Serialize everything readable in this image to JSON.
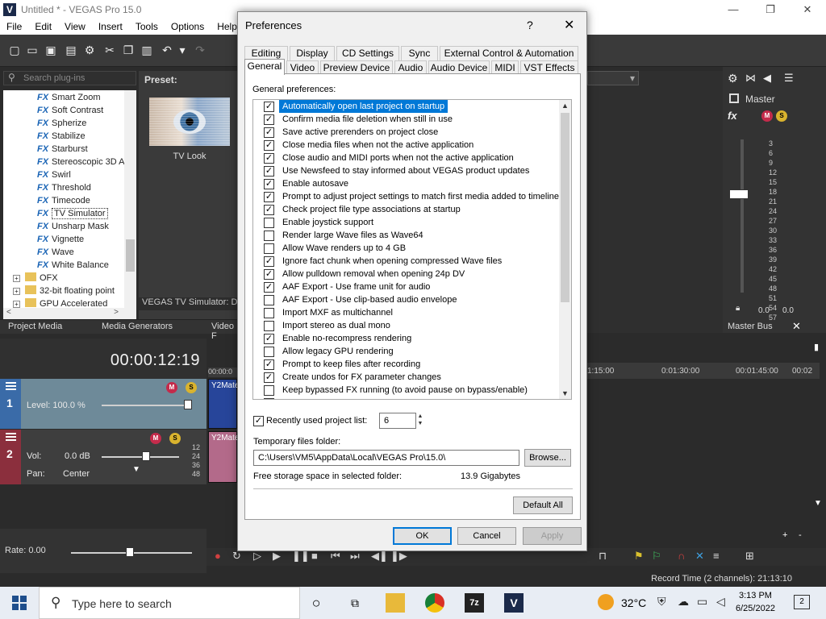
{
  "window": {
    "title": "Untitled * - VEGAS Pro 15.0",
    "controls": [
      "—",
      "❐",
      "✕"
    ]
  },
  "menu": [
    "File",
    "Edit",
    "View",
    "Insert",
    "Tools",
    "Options",
    "Help"
  ],
  "left_panel": {
    "search_placeholder": "Search plug-ins",
    "preset_label": "Preset:",
    "plugins": [
      "Smart Zoom",
      "Soft Contrast",
      "Spherize",
      "Stabilize",
      "Starburst",
      "Stereoscopic 3D A",
      "Swirl",
      "Threshold",
      "Timecode",
      "TV Simulator",
      "Unsharp Mask",
      "Vignette",
      "Wave",
      "White Balance"
    ],
    "fx_badge": "FX",
    "selected_plugin": "TV Simulator",
    "folders": [
      "OFX",
      "32-bit floating point",
      "GPU Accelerated"
    ],
    "preset_name": "TV Look",
    "status": "VEGAS TV Simulator: DXT",
    "tabs": [
      "Project Media",
      "Media Generators",
      "Video F"
    ]
  },
  "timeline": {
    "timecode": "00:00:12:19",
    "track1": {
      "number": "1",
      "level_label": "Level: 100.0 %",
      "level": 1.0,
      "clip_label": "Y2Mate"
    },
    "track2": {
      "number": "2",
      "vol_label": "Vol:",
      "vol_value": "0.0 dB",
      "pan_label": "Pan:",
      "pan_value": "Center",
      "clip_label": "Y2Mate"
    },
    "ruler_ticks": [
      "00:00:0",
      "1:15:00",
      "0:01:30:00",
      "00:01:45:00",
      "00:02"
    ],
    "levels": [
      "12",
      "24",
      "36",
      "48"
    ],
    "rate": "Rate: 0.00",
    "record_time": "Record Time (2 channels): 21:13:10"
  },
  "mixer": {
    "master_label": "Master",
    "fx_label": "fx",
    "scale": [
      "3",
      "6",
      "9",
      "12",
      "15",
      "18",
      "21",
      "24",
      "27",
      "30",
      "33",
      "36",
      "39",
      "42",
      "45",
      "48",
      "51",
      "54",
      "57"
    ],
    "readouts": [
      "0.0",
      "0.0"
    ],
    "master_bus": "Master Bus"
  },
  "dialog": {
    "title": "Preferences",
    "help": "?",
    "close": "✕",
    "tabs_row1": [
      "Editing",
      "Display",
      "CD Settings",
      "Sync",
      "External Control & Automation"
    ],
    "tabs_row2": [
      "General",
      "Video",
      "Preview Device",
      "Audio",
      "Audio Device",
      "MIDI",
      "VST Effects"
    ],
    "active_tab": "General",
    "section_label": "General preferences:",
    "preferences": [
      {
        "label": "Automatically open last project on startup",
        "checked": true
      },
      {
        "label": "Confirm media file deletion when still in use",
        "checked": true
      },
      {
        "label": "Save active prerenders on project close",
        "checked": true
      },
      {
        "label": "Close media files when not the active application",
        "checked": true
      },
      {
        "label": "Close audio and MIDI ports when not the active application",
        "checked": true
      },
      {
        "label": "Use Newsfeed to stay informed about VEGAS product updates",
        "checked": true
      },
      {
        "label": "Enable autosave",
        "checked": true
      },
      {
        "label": "Prompt to adjust project settings to match first media added to timeline",
        "checked": true
      },
      {
        "label": "Check project file type associations at startup",
        "checked": true
      },
      {
        "label": "Enable joystick support",
        "checked": false
      },
      {
        "label": "Render large Wave files as Wave64",
        "checked": false
      },
      {
        "label": "Allow Wave renders up to 4 GB",
        "checked": false
      },
      {
        "label": "Ignore fact chunk when opening compressed Wave files",
        "checked": true
      },
      {
        "label": "Allow pulldown removal when opening 24p DV",
        "checked": true
      },
      {
        "label": "AAF Export - Use frame unit for audio",
        "checked": true
      },
      {
        "label": "AAF Export - Use clip-based audio envelope",
        "checked": false
      },
      {
        "label": "Import MXF as multichannel",
        "checked": false
      },
      {
        "label": "Import stereo as dual mono",
        "checked": false
      },
      {
        "label": "Enable no-recompress rendering",
        "checked": true
      },
      {
        "label": "Allow legacy GPU rendering",
        "checked": false
      },
      {
        "label": "Prompt to keep files after recording",
        "checked": true
      },
      {
        "label": "Create undos for FX parameter changes",
        "checked": true
      },
      {
        "label": "Keep bypassed FX running (to avoid pause on bypass/enable)",
        "checked": false
      },
      {
        "label": "Automatically name regions and markers if not playing",
        "checked": true
      }
    ],
    "recent_projects_label": "Recently used project list:",
    "recent_projects_checked": true,
    "recent_projects_value": "6",
    "temp_folder_label": "Temporary files folder:",
    "temp_folder_value": "C:\\Users\\VM5\\AppData\\Local\\VEGAS Pro\\15.0\\",
    "browse_label": "Browse...",
    "free_storage_label": "Free storage space in selected folder:",
    "free_storage_value": "13.9 Gigabytes",
    "default_all_label": "Default All",
    "ok_label": "OK",
    "cancel_label": "Cancel",
    "apply_label": "Apply"
  },
  "taskbar": {
    "search_placeholder": "Type here to search",
    "temperature": "32°C",
    "time": "3:13 PM",
    "date": "6/25/2022",
    "notification_count": "2"
  },
  "colors": {
    "accent": "#0078d7",
    "app_dark": "#2b2b2b",
    "track1": "#6e8a99",
    "track2": "#8b2f3d"
  }
}
